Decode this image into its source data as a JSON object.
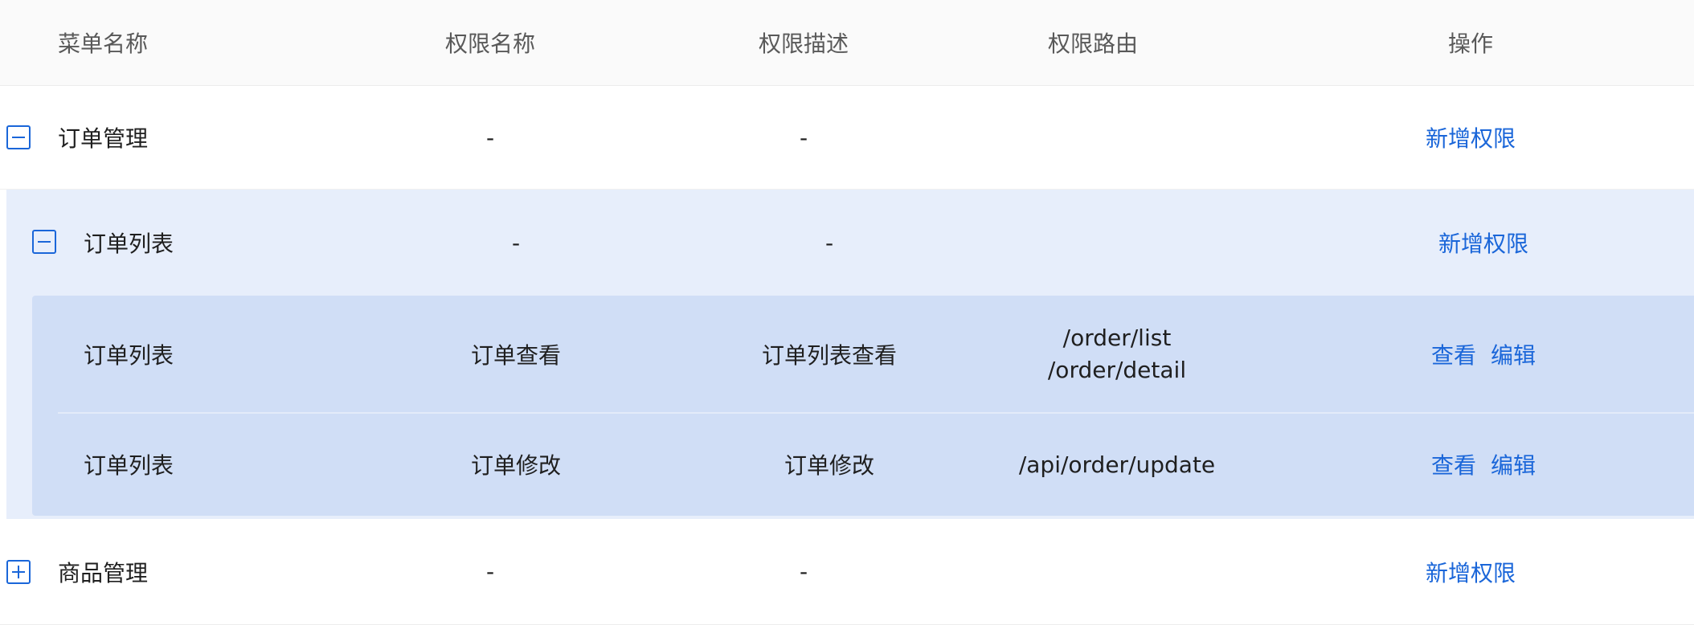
{
  "header": {
    "col_menu": "菜单名称",
    "col_perm_name": "权限名称",
    "col_perm_desc": "权限描述",
    "col_perm_route": "权限路由",
    "col_actions": "操作"
  },
  "rows": {
    "order_mgmt": {
      "menu": "订单管理",
      "perm_name": "-",
      "perm_desc": "-",
      "action": "新增权限",
      "expanded": true
    },
    "order_list": {
      "menu": "订单列表",
      "perm_name": "-",
      "perm_desc": "-",
      "action": "新增权限",
      "expanded": true
    },
    "perm_view": {
      "menu": "订单列表",
      "perm_name": "订单查看",
      "perm_desc": "订单列表查看",
      "route_1": "/order/list",
      "route_2": "/order/detail",
      "action_view": "查看",
      "action_edit": "编辑"
    },
    "perm_update": {
      "menu": "订单列表",
      "perm_name": "订单修改",
      "perm_desc": "订单修改",
      "route": "/api/order/update",
      "action_view": "查看",
      "action_edit": "编辑"
    },
    "product_mgmt": {
      "menu": "商品管理",
      "perm_name": "-",
      "perm_desc": "-",
      "action": "新增权限",
      "expanded": false
    }
  },
  "colors": {
    "link": "#1a66d9",
    "level2_bg": "#e7eefb",
    "level3_bg": "#d0def6",
    "header_bg": "#fafafa"
  },
  "icons": {
    "collapse": "minus-square-icon",
    "expand": "plus-square-icon"
  }
}
